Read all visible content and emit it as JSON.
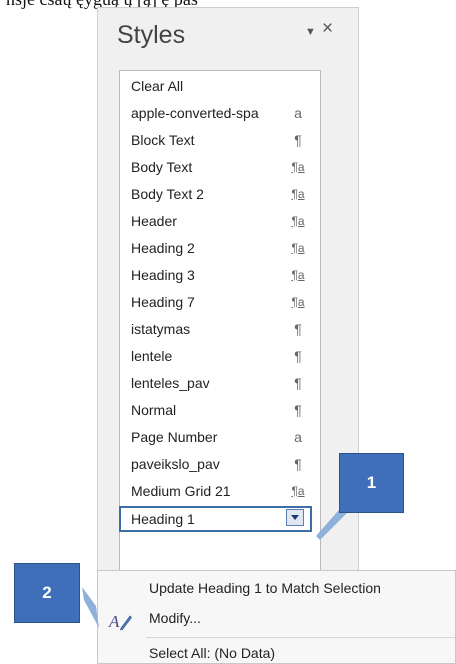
{
  "header_fragment": "nsje čsaų ęyguą ų [ą] ę pas",
  "pane": {
    "title": "Styles",
    "options_glyph": "▼",
    "close_glyph": "×"
  },
  "styles": [
    {
      "name": "Clear All",
      "glyph": ""
    },
    {
      "name": "apple-converted-spa",
      "glyph": "a"
    },
    {
      "name": "Block Text",
      "glyph": "¶"
    },
    {
      "name": "Body Text",
      "glyph": "¶a"
    },
    {
      "name": "Body Text 2",
      "glyph": "¶a"
    },
    {
      "name": "Header",
      "glyph": "¶a"
    },
    {
      "name": "Heading 2",
      "glyph": "¶a"
    },
    {
      "name": "Heading 3",
      "glyph": "¶a"
    },
    {
      "name": "Heading 7",
      "glyph": "¶a"
    },
    {
      "name": "istatymas",
      "glyph": "¶"
    },
    {
      "name": "lentele",
      "glyph": "¶"
    },
    {
      "name": "lenteles_pav",
      "glyph": "¶"
    },
    {
      "name": "Normal",
      "glyph": "¶"
    },
    {
      "name": "Page Number",
      "glyph": "a"
    },
    {
      "name": "paveikslo_pav",
      "glyph": "¶"
    },
    {
      "name": "Medium Grid 21",
      "glyph": "¶a"
    }
  ],
  "selected_style": "Heading 1",
  "menu": {
    "update": "Update Heading 1 to Match Selection",
    "modify": "Modify...",
    "select_all": "Select All: (No Data)"
  },
  "callouts": {
    "one": "1",
    "two": "2"
  },
  "colors": {
    "callout": "#3f6fb8",
    "selection_border": "#3d6ea8"
  }
}
